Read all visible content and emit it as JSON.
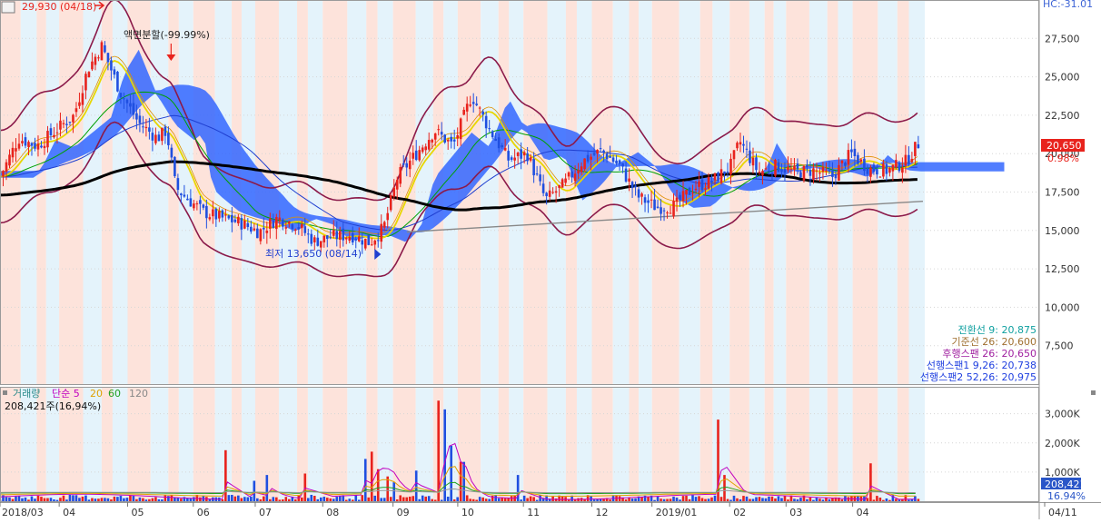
{
  "colors": {
    "up": "#e8231d",
    "down": "#1f4fe0",
    "cloud": "#3366ff",
    "band_red": "#fde3db",
    "band_blue": "#e4f3fb",
    "bollinger": "#8b1a4a",
    "ma5": "#e8231d",
    "ma20": "#e8d600",
    "ma60": "#00a000",
    "ma120": "#1f3fd0",
    "ma240": "#000000",
    "trend": "#888888"
  },
  "chart_data": [
    {
      "type": "candlestick",
      "title": "",
      "ylim": [
        5000,
        30000
      ],
      "y_ticks": [
        7500,
        10000,
        12500,
        15000,
        17500,
        20000,
        22500,
        25000,
        27500
      ],
      "y_tick_labels": [
        "7,500",
        "10,000",
        "12,500",
        "15,000",
        "17,500",
        "20,000",
        "22,500",
        "25,000",
        "27,500"
      ],
      "x_months": [
        {
          "label": "2018/03",
          "pos": 0.0
        },
        {
          "label": "04",
          "pos": 0.064
        },
        {
          "label": "05",
          "pos": 0.138
        },
        {
          "label": "06",
          "pos": 0.209
        },
        {
          "label": "07",
          "pos": 0.276
        },
        {
          "label": "08",
          "pos": 0.349
        },
        {
          "label": "09",
          "pos": 0.425
        },
        {
          "label": "10",
          "pos": 0.495
        },
        {
          "label": "11",
          "pos": 0.566
        },
        {
          "label": "12",
          "pos": 0.64
        },
        {
          "label": "2019/01",
          "pos": 0.705
        },
        {
          "label": "02",
          "pos": 0.789
        },
        {
          "label": "03",
          "pos": 0.85
        },
        {
          "label": "04",
          "pos": 0.922
        },
        {
          "label": "04/11",
          "pos": 1.0
        }
      ],
      "close_path": [
        [
          0.0,
          18500
        ],
        [
          0.02,
          21000
        ],
        [
          0.04,
          20500
        ],
        [
          0.06,
          21500
        ],
        [
          0.08,
          22500
        ],
        [
          0.095,
          25500
        ],
        [
          0.11,
          27000
        ],
        [
          0.12,
          25500
        ],
        [
          0.13,
          24000
        ],
        [
          0.15,
          22000
        ],
        [
          0.17,
          21000
        ],
        [
          0.18,
          21500
        ],
        [
          0.19,
          17800
        ],
        [
          0.2,
          17200
        ],
        [
          0.22,
          16200
        ],
        [
          0.24,
          15800
        ],
        [
          0.26,
          15500
        ],
        [
          0.28,
          14900
        ],
        [
          0.3,
          15800
        ],
        [
          0.32,
          15400
        ],
        [
          0.34,
          14300
        ],
        [
          0.36,
          14600
        ],
        [
          0.38,
          14700
        ],
        [
          0.4,
          14200
        ],
        [
          0.415,
          15200
        ],
        [
          0.43,
          18500
        ],
        [
          0.45,
          20000
        ],
        [
          0.47,
          21500
        ],
        [
          0.49,
          20500
        ],
        [
          0.51,
          23800
        ],
        [
          0.53,
          21500
        ],
        [
          0.55,
          19600
        ],
        [
          0.57,
          20000
        ],
        [
          0.59,
          17000
        ],
        [
          0.61,
          18000
        ],
        [
          0.63,
          19500
        ],
        [
          0.65,
          20200
        ],
        [
          0.67,
          19200
        ],
        [
          0.69,
          17200
        ],
        [
          0.71,
          16500
        ],
        [
          0.73,
          16600
        ],
        [
          0.75,
          17800
        ],
        [
          0.77,
          18200
        ],
        [
          0.79,
          19200
        ],
        [
          0.8,
          20800
        ],
        [
          0.82,
          18800
        ],
        [
          0.84,
          19200
        ],
        [
          0.86,
          18800
        ],
        [
          0.88,
          18900
        ],
        [
          0.9,
          18500
        ],
        [
          0.92,
          20000
        ],
        [
          0.94,
          19000
        ],
        [
          0.96,
          18900
        ],
        [
          0.98,
          19500
        ],
        [
          0.993,
          20650
        ]
      ],
      "last_price": {
        "label": "20,650",
        "value": 20650,
        "change_pct": "0.98%"
      },
      "annotations": {
        "high": {
          "text": "29,930 (04/18)",
          "value": 29930,
          "pos": 0.11
        },
        "split": {
          "text": "액면분할(-99.99%)",
          "pos": 0.17
        },
        "low": {
          "text": "최저 13,650 (08/14)",
          "value": 13650,
          "pos": 0.385
        },
        "corner": "HC:-31.01"
      },
      "ichimoku_legend": [
        "전환선 9: 20,875",
        "기준선 26: 20,600",
        "후행스팬 26: 20,650",
        "선행스팬1 9,26: 20,738",
        "선행스팬2 52,26: 20,975"
      ]
    },
    {
      "type": "bar",
      "title": "거래량",
      "ylim": [
        0,
        3800
      ],
      "y_ticks": [
        1000,
        2000,
        3000
      ],
      "y_tick_labels": [
        "1,000K",
        "2,000K",
        "3,000K"
      ],
      "legend": [
        {
          "name": "거래량",
          "color": "#3a8a8a"
        },
        {
          "name": "단순 5",
          "color": "#c000c0"
        },
        {
          "name": "20",
          "color": "#e0a000"
        },
        {
          "name": "60",
          "color": "#20a020"
        },
        {
          "name": "120",
          "color": "#999999"
        }
      ],
      "volume_text": "208,421주(16,94%)",
      "last_volume": {
        "label": "208,421",
        "value": 208,
        "change_pct": "16.94%"
      },
      "spikes_k": [
        {
          "pos": 0.245,
          "value": 1750
        },
        {
          "pos": 0.275,
          "value": 700
        },
        {
          "pos": 0.29,
          "value": 900
        },
        {
          "pos": 0.33,
          "value": 950
        },
        {
          "pos": 0.395,
          "value": 1450
        },
        {
          "pos": 0.403,
          "value": 1700
        },
        {
          "pos": 0.41,
          "value": 1100
        },
        {
          "pos": 0.418,
          "value": 850
        },
        {
          "pos": 0.425,
          "value": 650
        },
        {
          "pos": 0.45,
          "value": 1050
        },
        {
          "pos": 0.475,
          "value": 3450
        },
        {
          "pos": 0.481,
          "value": 3150
        },
        {
          "pos": 0.487,
          "value": 1900
        },
        {
          "pos": 0.5,
          "value": 1350
        },
        {
          "pos": 0.56,
          "value": 900
        },
        {
          "pos": 0.775,
          "value": 2800
        },
        {
          "pos": 0.785,
          "value": 900
        },
        {
          "pos": 0.942,
          "value": 1300
        }
      ]
    }
  ]
}
